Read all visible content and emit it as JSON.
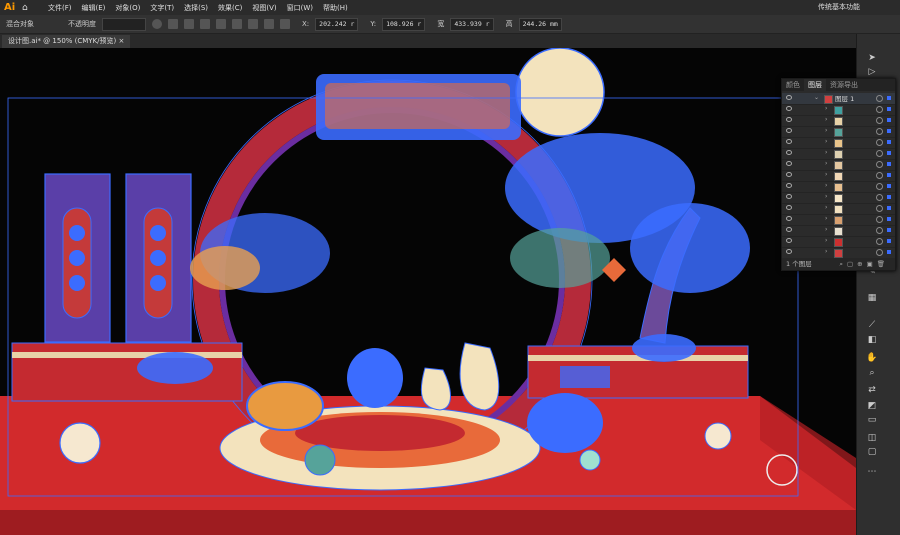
{
  "app": {
    "logo": "Ai",
    "workspace": "传统基本功能"
  },
  "menu": [
    "文件(F)",
    "编辑(E)",
    "对象(O)",
    "文字(T)",
    "选择(S)",
    "效果(C)",
    "视图(V)",
    "窗口(W)",
    "帮助(H)"
  ],
  "control": {
    "mixed_label": "混合对象",
    "opacity_label": "不透明度",
    "x_label": "X:",
    "x_value": "202.242 r",
    "y_label": "Y:",
    "y_value": "108.926 r",
    "w_label": "宽",
    "w_value": "433.939 r",
    "h_label": "高",
    "h_value": "244.26 mm"
  },
  "document": {
    "tab_title": "设计图.ai* @ 150% (CMYK/预览)"
  },
  "layers_panel": {
    "tabs": [
      "颜色",
      "图层",
      "资源导出"
    ],
    "top_layer_name": "图层 1",
    "footer_text": "1 个图层",
    "sublayer_colors": [
      "#3fa0a0",
      "#e8d2a8",
      "#56a39a",
      "#e9c48a",
      "#ddd0b0",
      "#e4c7a0",
      "#f2d8b6",
      "#e8c090",
      "#f6e6c8",
      "#f0e0c0",
      "#d8a070",
      "#e8e0d0",
      "#cc3030",
      "#d04040"
    ]
  },
  "colors": {
    "selection": "#3b6cff",
    "red": "#d62a2e",
    "purple": "#5a3fa8",
    "cream": "#f3e3bd"
  }
}
